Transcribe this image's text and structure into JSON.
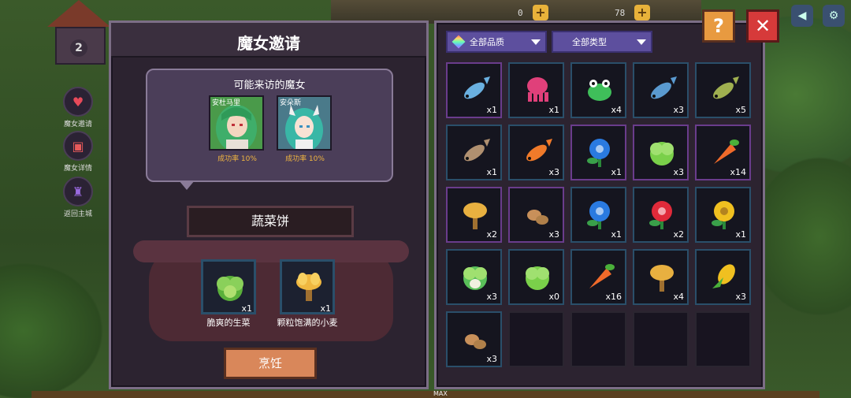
{
  "hud": {
    "resource_value": "78",
    "resource_value_2": "0",
    "house_level": "2"
  },
  "sidebar": [
    {
      "label": "魔女邀请",
      "icon": "heart-icon"
    },
    {
      "label": "魔女详情",
      "icon": "gift-icon"
    },
    {
      "label": "返回主城",
      "icon": "castle-icon"
    }
  ],
  "left_panel": {
    "title": "魔女邀请",
    "visit_title": "可能来访的魔女",
    "witches": [
      {
        "name": "安杜马里",
        "rate": "成功率 10%",
        "hair": "#3fae6a",
        "accent": "#2a7a4a"
      },
      {
        "name": "安朵斯",
        "rate": "成功率 10%",
        "hair": "#39b7a6",
        "accent": "#2a6a8a"
      }
    ],
    "recipe_name": "蔬菜饼",
    "ingredients": [
      {
        "label": "脆爽的生菜",
        "qty": "x1",
        "icon": "lettuce-icon"
      },
      {
        "label": "颗粒饱满的小麦",
        "qty": "x1",
        "icon": "wheat-icon"
      }
    ],
    "cook_label": "烹饪"
  },
  "right_panel": {
    "filter_quality": "全部品质",
    "filter_type": "全部类型",
    "items": [
      {
        "icon": "fish-icon",
        "qty": "x1",
        "rarity": "purple",
        "color": "#6ab0e0"
      },
      {
        "icon": "octopus-icon",
        "qty": "x1",
        "rarity": "blue",
        "color": "#e0407a"
      },
      {
        "icon": "frog-icon",
        "qty": "x4",
        "rarity": "blue",
        "color": "#3fbf5a"
      },
      {
        "icon": "fish-icon",
        "qty": "x3",
        "rarity": "blue",
        "color": "#5a9ad0"
      },
      {
        "icon": "pufferfish-icon",
        "qty": "x5",
        "rarity": "blue",
        "color": "#a0b050"
      },
      {
        "icon": "catfish-icon",
        "qty": "x1",
        "rarity": "blue",
        "color": "#b09070"
      },
      {
        "icon": "goldfish-icon",
        "qty": "x3",
        "rarity": "blue",
        "color": "#f07a2a"
      },
      {
        "icon": "blue-flower-icon",
        "qty": "x1",
        "rarity": "purple",
        "color": "#2a7ae0"
      },
      {
        "icon": "lettuce-icon",
        "qty": "x3",
        "rarity": "purple",
        "color": "#7ad04a"
      },
      {
        "icon": "carrot-icon",
        "qty": "x14",
        "rarity": "purple",
        "color": "#f06a2a"
      },
      {
        "icon": "wheat-icon",
        "qty": "x2",
        "rarity": "purple",
        "color": "#e8b040"
      },
      {
        "icon": "potato-icon",
        "qty": "x3",
        "rarity": "purple",
        "color": "#c8905a"
      },
      {
        "icon": "blue-flower-icon",
        "qty": "x1",
        "rarity": "blue",
        "color": "#2a7ae0"
      },
      {
        "icon": "red-flower-icon",
        "qty": "x2",
        "rarity": "blue",
        "color": "#e02a3a"
      },
      {
        "icon": "sunflower-icon",
        "qty": "x1",
        "rarity": "blue",
        "color": "#f0c020"
      },
      {
        "icon": "cabbage-icon",
        "qty": "x3",
        "rarity": "blue",
        "color": "#5ac05a"
      },
      {
        "icon": "lettuce-icon",
        "qty": "x0",
        "rarity": "blue",
        "color": "#7ad04a"
      },
      {
        "icon": "carrot-icon",
        "qty": "x16",
        "rarity": "blue",
        "color": "#f06a2a"
      },
      {
        "icon": "wheat-icon",
        "qty": "x4",
        "rarity": "blue",
        "color": "#e8b040"
      },
      {
        "icon": "corn-icon",
        "qty": "x3",
        "rarity": "blue",
        "color": "#f0c020"
      },
      {
        "icon": "potato-icon",
        "qty": "x3",
        "rarity": "blue",
        "color": "#c8905a"
      },
      {
        "icon": "",
        "qty": "",
        "rarity": "empty",
        "color": ""
      },
      {
        "icon": "",
        "qty": "",
        "rarity": "empty",
        "color": ""
      },
      {
        "icon": "",
        "qty": "",
        "rarity": "empty",
        "color": ""
      },
      {
        "icon": "",
        "qty": "",
        "rarity": "empty",
        "color": ""
      }
    ]
  },
  "buttons": {
    "help_label": "?",
    "close_label": "✕"
  },
  "footer": {
    "max_label": "MAX"
  }
}
